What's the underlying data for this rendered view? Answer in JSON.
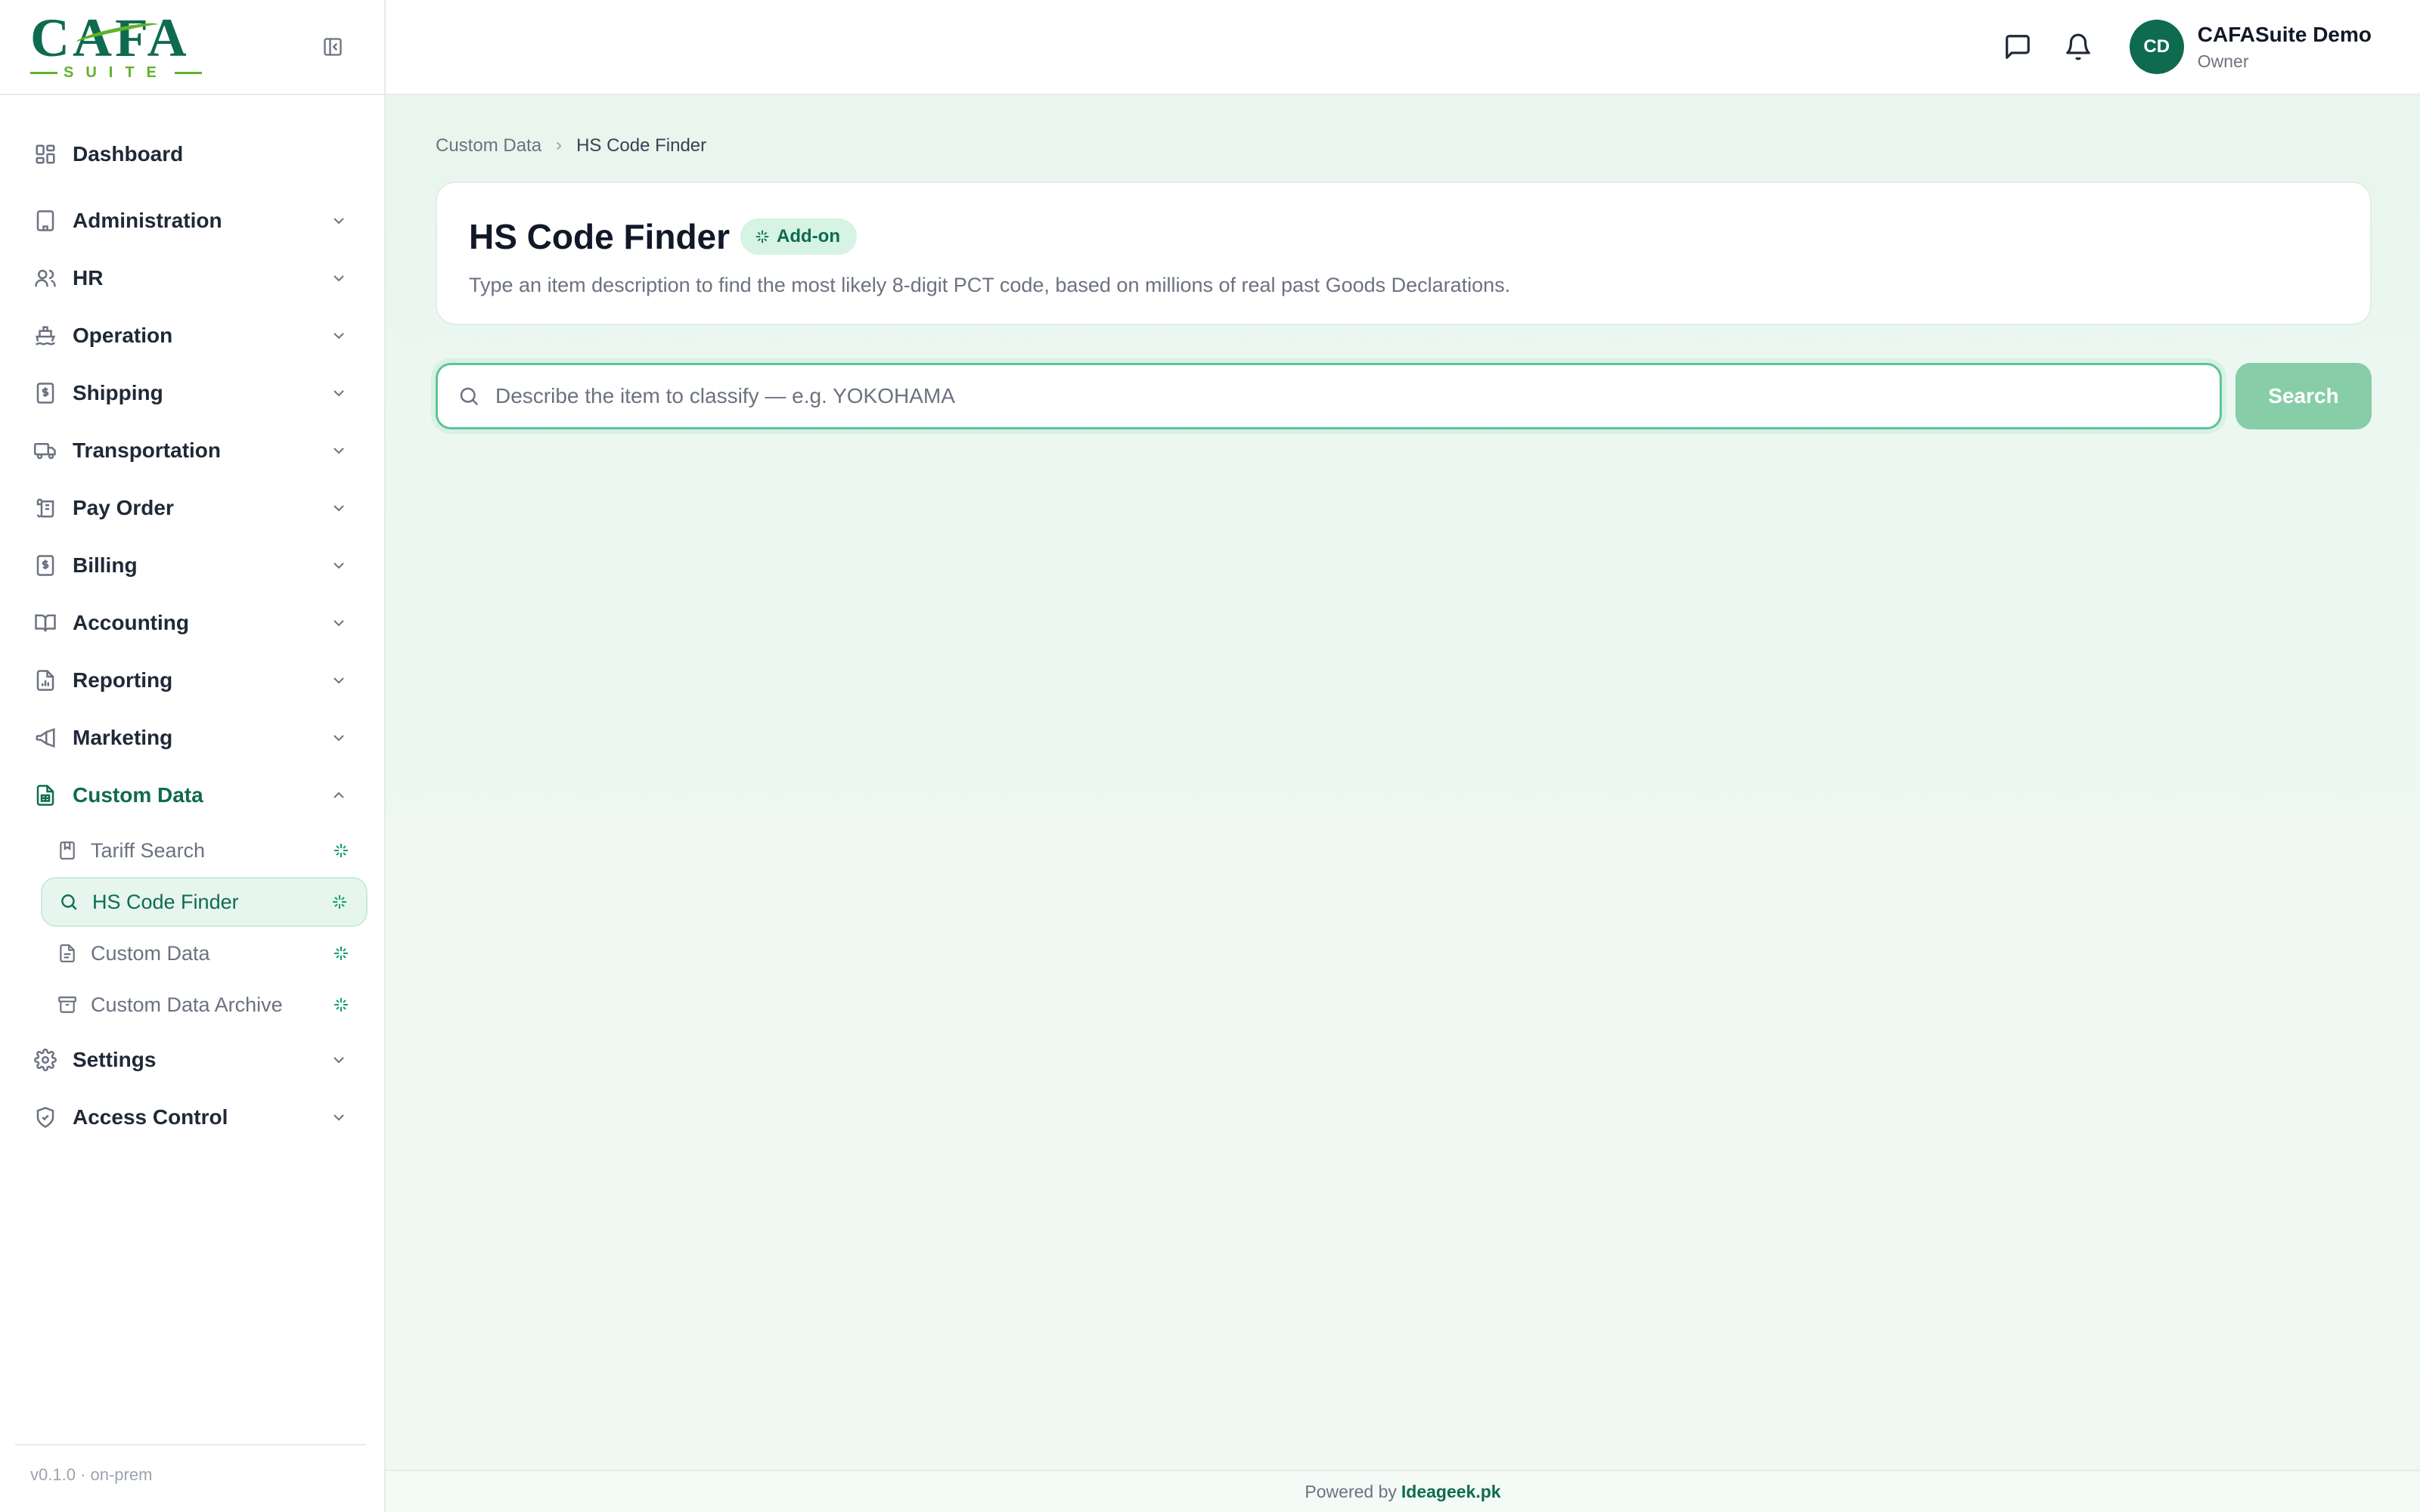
{
  "brand": {
    "logo_main": "CAFA",
    "logo_sub": "SUITE"
  },
  "sidebar": {
    "dashboard": "Dashboard",
    "items": [
      {
        "label": "Administration"
      },
      {
        "label": "HR"
      },
      {
        "label": "Operation"
      },
      {
        "label": "Shipping"
      },
      {
        "label": "Transportation"
      },
      {
        "label": "Pay Order"
      },
      {
        "label": "Billing"
      },
      {
        "label": "Accounting"
      },
      {
        "label": "Reporting"
      },
      {
        "label": "Marketing"
      }
    ],
    "custom_data": {
      "label": "Custom Data",
      "children": [
        {
          "label": "Tariff Search"
        },
        {
          "label": "HS Code Finder"
        },
        {
          "label": "Custom Data"
        },
        {
          "label": "Custom Data Archive"
        }
      ]
    },
    "settings": "Settings",
    "access_control": "Access Control",
    "version": "v0.1.0 · on-prem"
  },
  "topbar": {
    "user_initials": "CD",
    "user_name": "CAFASuite Demo",
    "user_role": "Owner"
  },
  "breadcrumb": {
    "parent": "Custom Data",
    "current": "HS Code Finder"
  },
  "page": {
    "title": "HS Code Finder",
    "badge": "Add-on",
    "subtitle": "Type an item description to find the most likely 8-digit PCT code, based on millions of real past Goods Declarations."
  },
  "search": {
    "placeholder": "Describe the item to classify — e.g. YOKOHAMA",
    "value": "",
    "button": "Search"
  },
  "footer": {
    "prefix": "Powered by",
    "link": "Ideageek.pk"
  },
  "colors": {
    "accent": "#0f6b4f",
    "brand_green": "#5fb32c",
    "button": "#86cda8"
  }
}
